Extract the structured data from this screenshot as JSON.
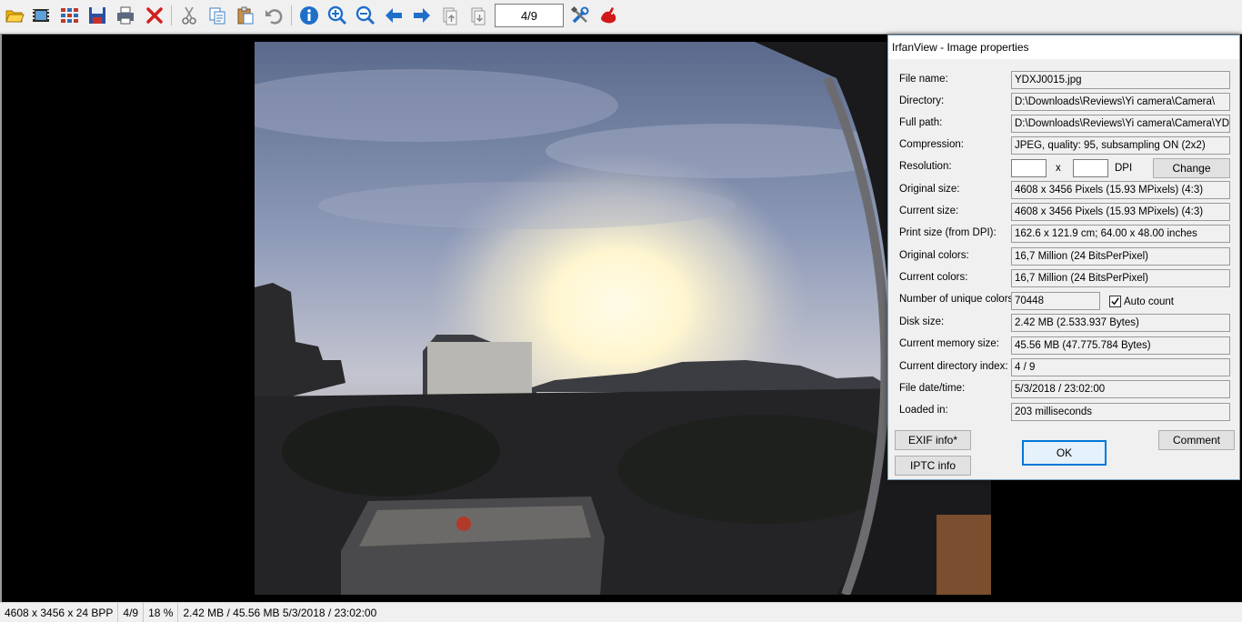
{
  "toolbar": {
    "page_indicator": "4/9",
    "buttons": [
      {
        "name": "open-folder-icon",
        "color": "#e8a800"
      },
      {
        "name": "slideshow-icon",
        "color": "#3a6ea5"
      },
      {
        "name": "thumbnails-icon",
        "color": "#c0392b"
      },
      {
        "name": "save-icon",
        "color": "#2c4f9e"
      },
      {
        "name": "print-icon",
        "color": "#555555"
      },
      {
        "name": "delete-icon",
        "color": "#d02020"
      },
      {
        "name": "cut-icon",
        "color": "#777777"
      },
      {
        "name": "copy-icon",
        "color": "#3b7fc4"
      },
      {
        "name": "paste-icon",
        "color": "#b08040"
      },
      {
        "name": "undo-icon",
        "color": "#888888"
      },
      {
        "name": "info-icon",
        "color": "#1f6fc9"
      },
      {
        "name": "zoom-in-icon",
        "color": "#1f6fc9"
      },
      {
        "name": "zoom-out-icon",
        "color": "#1f6fc9"
      },
      {
        "name": "previous-arrow-icon",
        "color": "#1f6fc9"
      },
      {
        "name": "next-arrow-icon",
        "color": "#1f6fc9"
      },
      {
        "name": "first-page-icon",
        "color": "#999999"
      },
      {
        "name": "last-page-icon",
        "color": "#999999"
      },
      {
        "name": "settings-tools-icon",
        "color": "#1f6fc9"
      },
      {
        "name": "irfanview-logo-icon",
        "color": "#d01818"
      }
    ]
  },
  "dialog": {
    "title": "IrfanView - Image properties",
    "properties": [
      {
        "label": "File name:",
        "value": "YDXJ0015.jpg"
      },
      {
        "label": "Directory:",
        "value": "D:\\Downloads\\Reviews\\Yi camera\\Camera\\"
      },
      {
        "label": "Full path:",
        "value": "D:\\Downloads\\Reviews\\Yi camera\\Camera\\YDXJ0015.jpg"
      },
      {
        "label": "Compression:",
        "value": "JPEG, quality: 95, subsampling ON (2x2)"
      },
      {
        "label": "Resolution:",
        "value": ""
      },
      {
        "label": "Original size:",
        "value": "4608 x 3456  Pixels (15.93 MPixels) (4:3)"
      },
      {
        "label": "Current size:",
        "value": "4608 x 3456  Pixels (15.93 MPixels) (4:3)"
      },
      {
        "label": "Print size (from DPI):",
        "value": "162.6 x 121.9 cm; 64.00 x 48.00 inches"
      },
      {
        "label": "Original colors:",
        "value": "16,7 Million   (24 BitsPerPixel)"
      },
      {
        "label": "Current colors:",
        "value": "16,7 Million   (24 BitsPerPixel)"
      },
      {
        "label": "Number of unique colors:",
        "value": "70448"
      },
      {
        "label": "Disk size:",
        "value": "2.42 MB (2.533.937 Bytes)"
      },
      {
        "label": "Current memory size:",
        "value": "45.56  MB (47.775.784 Bytes)"
      },
      {
        "label": "Current directory index:",
        "value": "4  /  9"
      },
      {
        "label": "File date/time:",
        "value": "5/3/2018 / 23:02:00"
      },
      {
        "label": "Loaded in:",
        "value": "203 milliseconds"
      }
    ],
    "resolution_x_label": "x",
    "resolution_unit": "DPI",
    "change_button": "Change",
    "auto_count_label": "Auto count",
    "auto_count_checked": true,
    "exif_button": "EXIF info*",
    "iptc_button": "IPTC info",
    "ok_button": "OK",
    "comment_button": "Comment"
  },
  "statusbar": {
    "dimensions": "4608 x 3456 x 24 BPP",
    "index": "4/9",
    "zoom": "18 %",
    "sizes_date": "2.42 MB / 45.56 MB 5/3/2018 / 23:02:00"
  }
}
